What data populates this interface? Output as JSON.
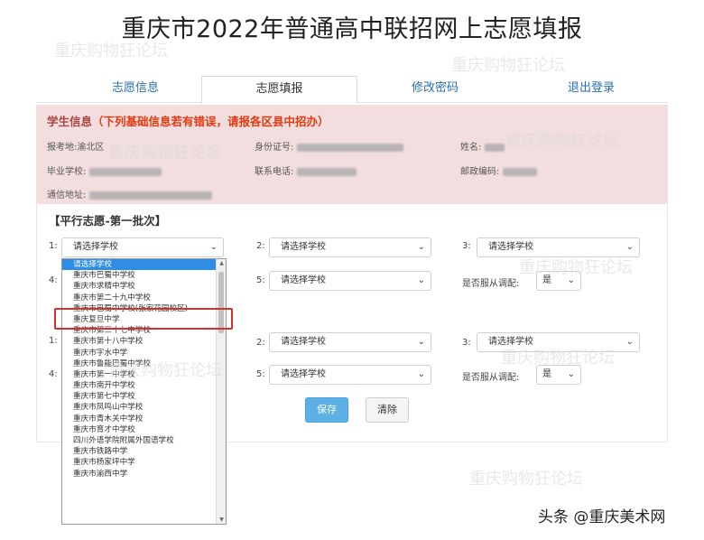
{
  "page": {
    "title": "重庆市2022年普通高中联招网上志愿填报"
  },
  "tabs": [
    "志愿信息",
    "志愿填报",
    "修改密码",
    "退出登录"
  ],
  "info": {
    "heading": "学生信息",
    "warning": "（下列基础信息若有错误，请报各区县中招办）",
    "exam_area_label": "报考地:",
    "exam_area_value": "渝北区",
    "id_label": "身份证号:",
    "name_label": "姓名:",
    "school_label": "毕业学校:",
    "phone_label": "联系电话:",
    "zip_label": "邮政编码:",
    "address_label": "通信地址:"
  },
  "form": {
    "section_title": "【平行志愿-第一批次】",
    "numbers": [
      "1:",
      "2:",
      "3:",
      "4:",
      "5:",
      "1:",
      "2:",
      "3:",
      "4:",
      "5:"
    ],
    "select_placeholder": "请选择学校",
    "adjust_label": "是否服从调配:",
    "adjust_value": "是",
    "save_label": "保存",
    "clear_label": "清除"
  },
  "dropdown": {
    "items": [
      "请选择学校",
      "重庆市巴蜀中学校",
      "重庆市求精中学校",
      "重庆市第二十九中学校",
      "重庆市巴蜀中学校(张家花园校区)",
      "重庆复旦中学",
      "重庆市第三十七中学校",
      "重庆市第十八中学校",
      "重庆市字水中学",
      "重庆市鲁能巴蜀中学校",
      "重庆市第一中学校",
      "重庆市南开中学校",
      "重庆市第七中学校",
      "重庆市凤鸣山中学校",
      "重庆市青木关中学校",
      "重庆市育才中学校",
      "四川外语学院附属外国语学校",
      "重庆市铁路中学",
      "重庆市杨家坪中学",
      "重庆市渝西中学"
    ],
    "selected_index": 0,
    "highlighted_index": 4
  },
  "watermarks": [
    "重庆购物狂论坛",
    "重庆购物狂论坛",
    "重庆购物狂论坛",
    "重庆购物狂论坛",
    "重庆购物狂论坛",
    "重庆购物狂论坛",
    "重庆购物狂论坛",
    "重庆购物狂论坛"
  ],
  "credit": "头条 @重庆美术网",
  "colors": {
    "accent": "#2e8ee6",
    "info_bg": "#f2dede",
    "warning": "#e4380d",
    "highlight": "#d9302b",
    "save": "#5cb0e4"
  }
}
